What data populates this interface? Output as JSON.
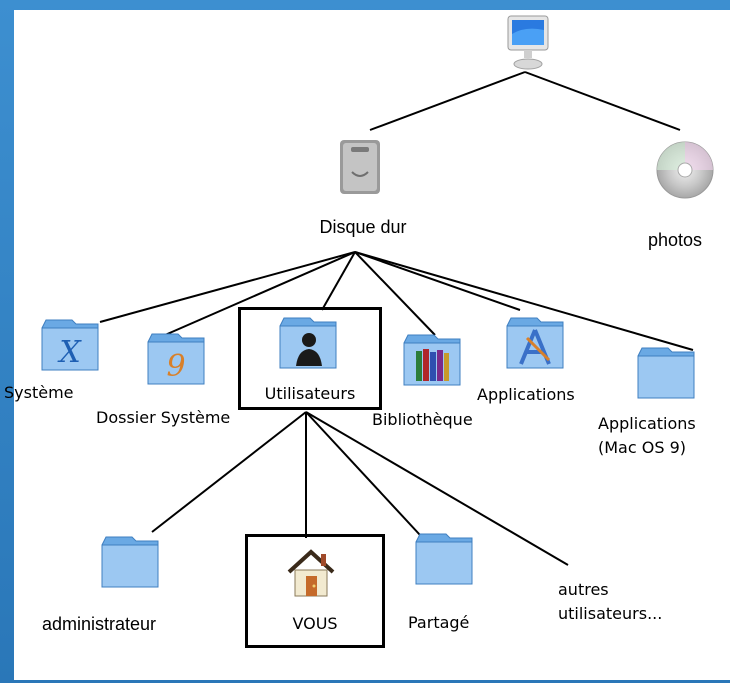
{
  "diagram": {
    "nodes": {
      "computer": {
        "icon": "computer-icon"
      },
      "disk": {
        "icon": "hard-disk-icon",
        "label": "Disque dur"
      },
      "photos": {
        "icon": "cd-disc-icon",
        "label": "photos"
      },
      "systeme": {
        "icon": "folder-x-icon",
        "label": "Système"
      },
      "dossier_systeme": {
        "icon": "folder-9-icon",
        "label": "Dossier Système"
      },
      "utilisateurs": {
        "icon": "folder-user-icon",
        "label": "Utilisateurs"
      },
      "bibliotheque": {
        "icon": "folder-library-icon",
        "label": "Bibliothèque"
      },
      "applications": {
        "icon": "folder-applications-icon",
        "label": "Applications"
      },
      "applications_os9": {
        "icon": "folder-icon",
        "label_line1": "Applications",
        "label_line2": "(Mac OS 9)"
      },
      "administrateur": {
        "icon": "folder-icon",
        "label": "administrateur"
      },
      "vous": {
        "icon": "home-icon",
        "label": "VOUS"
      },
      "partage": {
        "icon": "folder-icon",
        "label": "Partagé"
      },
      "autres": {
        "label_line1": "autres",
        "label_line2": "utilisateurs..."
      }
    },
    "highlighted": [
      "Utilisateurs",
      "VOUS"
    ],
    "colors": {
      "background": "#2f7fbf",
      "folder": "#7fb8ea",
      "box": "#000000"
    }
  }
}
